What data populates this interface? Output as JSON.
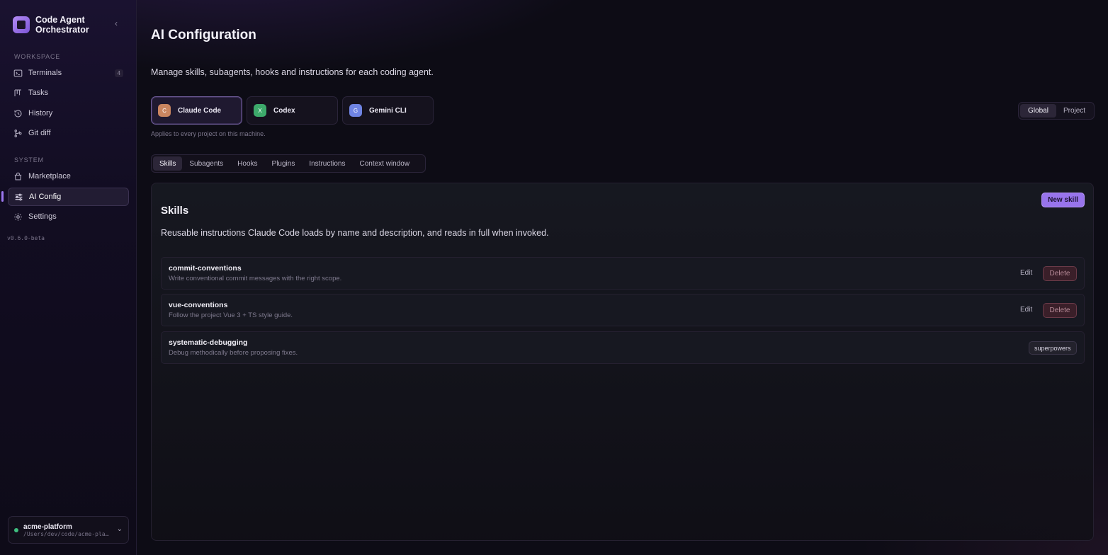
{
  "brand": {
    "title": "Code Agent Orchestrator",
    "accent": "#9b77ee"
  },
  "sidebar": {
    "workspace_label": "WORKSPACE",
    "system_label": "SYSTEM",
    "workspace_items": [
      {
        "label": "Terminals",
        "icon": "terminal-icon",
        "badge": "4"
      },
      {
        "label": "Tasks",
        "icon": "kanban-icon"
      },
      {
        "label": "History",
        "icon": "history-icon"
      },
      {
        "label": "Git diff",
        "icon": "git-icon"
      }
    ],
    "system_items": [
      {
        "label": "Marketplace",
        "icon": "shopping-bag-icon"
      },
      {
        "label": "AI Config",
        "icon": "sliders-icon",
        "active": true
      },
      {
        "label": "Settings",
        "icon": "gear-icon"
      }
    ],
    "version": "v0.6.0-beta",
    "project": {
      "name": "acme-platform",
      "path": "/Users/dev/code/acme-platform",
      "status_color": "#3fbf7f"
    }
  },
  "header": {
    "title": "AI Configuration",
    "subtitle": "Manage skills, subagents, hooks and instructions for each coding agent."
  },
  "agents": [
    {
      "label": "Claude Code",
      "letter": "C",
      "color": "#c98560",
      "active": true
    },
    {
      "label": "Codex",
      "letter": "X",
      "color": "#3daa6b"
    },
    {
      "label": "Gemini CLI",
      "letter": "G",
      "color": "#6f84e3"
    }
  ],
  "scope": {
    "hint": "Applies to every project on this machine.",
    "options": [
      "Global",
      "Project"
    ],
    "selected": "Global"
  },
  "tabs": [
    {
      "label": "Skills",
      "active": true
    },
    {
      "label": "Subagents"
    },
    {
      "label": "Hooks"
    },
    {
      "label": "Plugins"
    },
    {
      "label": "Instructions"
    },
    {
      "label": "Context window"
    }
  ],
  "skills_panel": {
    "title": "Skills",
    "description": "Reusable instructions Claude Code loads by name and description, and reads in full when invoked.",
    "new_label": "New skill",
    "edit_label": "Edit",
    "delete_label": "Delete",
    "items": [
      {
        "name": "commit-conventions",
        "description": "Write conventional commit messages with the right scope."
      },
      {
        "name": "vue-conventions",
        "description": "Follow the project Vue 3 + TS style guide."
      },
      {
        "name": "systematic-debugging",
        "description": "Debug methodically before proposing fixes.",
        "source": "superpowers"
      }
    ]
  }
}
